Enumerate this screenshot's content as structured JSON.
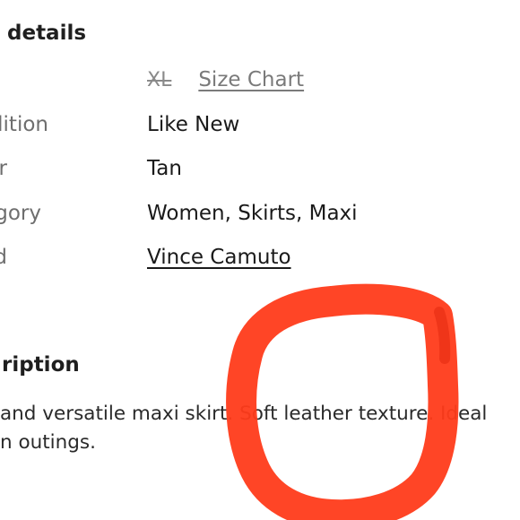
{
  "details": {
    "heading": "details",
    "rows": [
      {
        "label": "",
        "value": "XL",
        "link": "Size Chart"
      },
      {
        "label": "lition",
        "value": "Like New"
      },
      {
        "label": "r",
        "value": "Tan"
      },
      {
        "label": "gory",
        "value": "Women, Skirts, Maxi"
      },
      {
        "label": "d",
        "value": "Vince Camuto"
      }
    ]
  },
  "description": {
    "heading": "ription",
    "line1": "and versatile maxi skirt. Soft leather texture. Ideal",
    "line2": "n outings."
  },
  "colors": {
    "annotation": "#ff3b1a",
    "label": "#6e6e6e",
    "value": "#1a1a1a"
  }
}
